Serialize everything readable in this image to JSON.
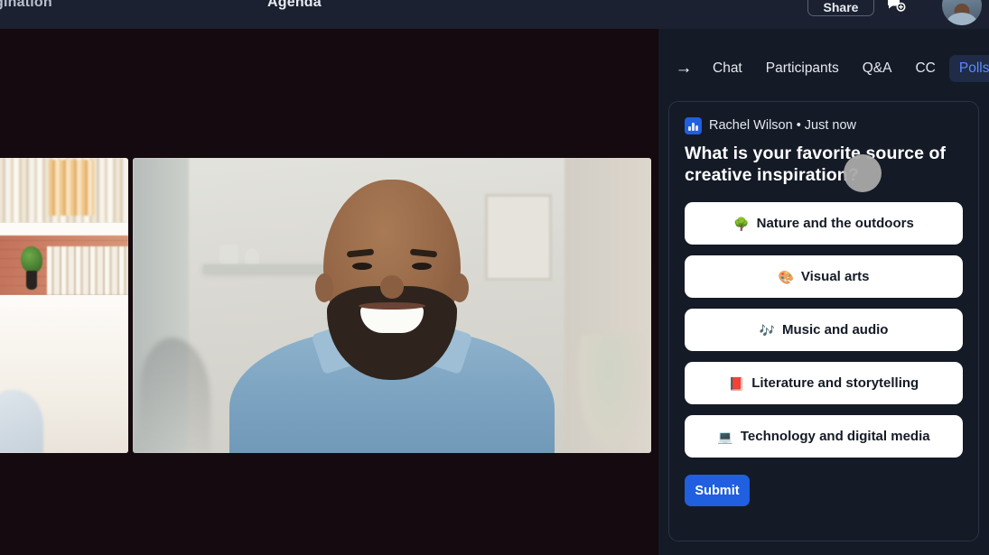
{
  "header": {
    "title": "gination",
    "agenda_label": "Agenda",
    "share_label": "Share",
    "reactions_icon": "chat-reaction-icon",
    "avatar": "user-avatar"
  },
  "stage": {
    "side_tile": "participant-video-side",
    "main_tile": "participant-video-main"
  },
  "panel": {
    "collapse_icon": "arrow-right-icon",
    "tabs": [
      {
        "label": "Chat",
        "active": false
      },
      {
        "label": "Participants",
        "active": false
      },
      {
        "label": "Q&A",
        "active": false
      },
      {
        "label": "CC",
        "active": false
      },
      {
        "label": "Polls",
        "active": true
      }
    ],
    "poll": {
      "author": "Rachel Wilson • Just now",
      "author_icon": "poll-bar-chart-icon",
      "question": "What is your favorite source of creative inspiration?",
      "options": [
        {
          "emoji": "🌳",
          "emoji_name": "tree-emoji",
          "label": "Nature and the outdoors"
        },
        {
          "emoji": "🎨",
          "emoji_name": "artist-palette-emoji",
          "label": "Visual arts"
        },
        {
          "emoji": "🎶",
          "emoji_name": "musical-notes-emoji",
          "label": "Music and audio"
        },
        {
          "emoji": "📕",
          "emoji_name": "closed-book-emoji",
          "label": "Literature and storytelling"
        },
        {
          "emoji": "💻",
          "emoji_name": "laptop-emoji",
          "label": "Technology and digital media"
        }
      ],
      "submit_label": "Submit"
    }
  },
  "colors": {
    "accent_blue": "#1f5fe0",
    "tab_active_text": "#5b8bff",
    "panel_bg": "#141a26",
    "stage_bg": "#150a0f",
    "header_bg": "#1b2130"
  },
  "cursor": {
    "name": "mouse-cursor-highlight"
  }
}
